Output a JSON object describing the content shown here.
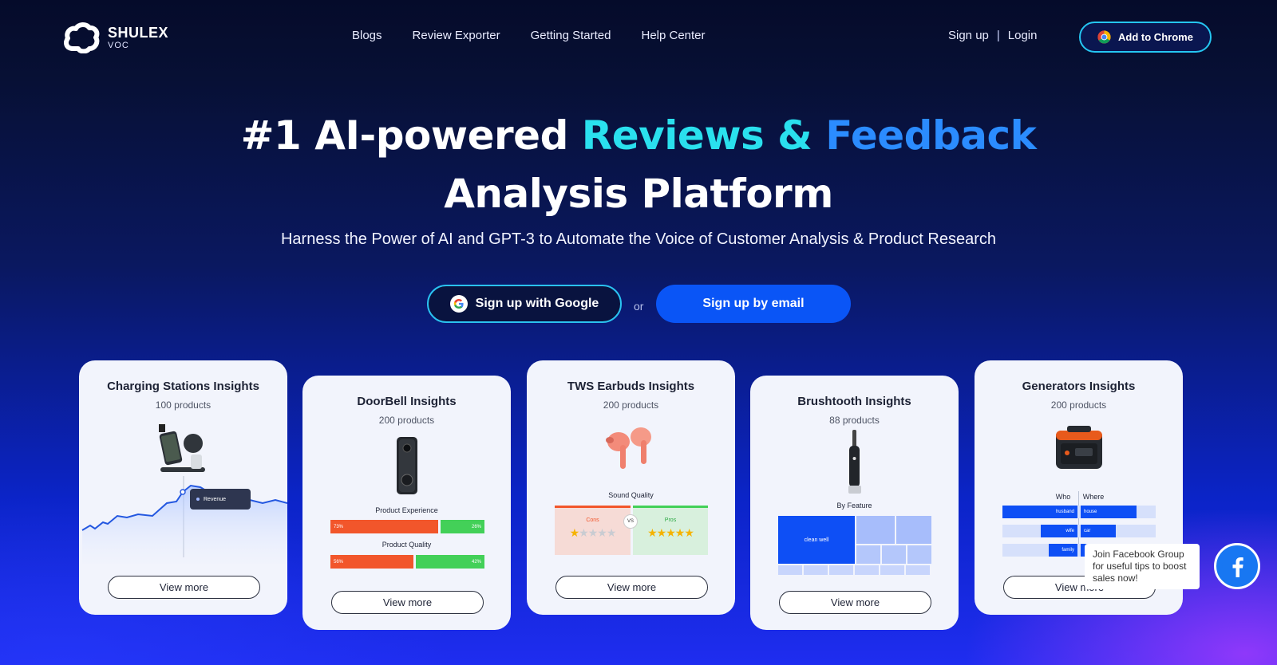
{
  "brand": {
    "name": "SHULEX",
    "sub": "VOC"
  },
  "nav": {
    "links": [
      "Blogs",
      "Review Exporter",
      "Getting Started",
      "Help Center"
    ],
    "signup": "Sign up",
    "separator": "|",
    "login": "Login",
    "chrome_button": "Add to Chrome"
  },
  "hero": {
    "title_part1": "#1 AI-powered ",
    "title_highlight1": "Reviews & ",
    "title_highlight2": "Feedback",
    "title_line2": "Analysis Platform",
    "subtitle": "Harness the Power of AI and GPT-3 to Automate the Voice of Customer Analysis & Product Research",
    "google_button": "Sign up with Google",
    "or": "or",
    "email_button": "Sign up by email"
  },
  "cards": [
    {
      "title": "Charging Stations Insights",
      "count": "100 products",
      "tooltip": "Revenue",
      "button": "View more"
    },
    {
      "title": "DoorBell Insights",
      "count": "200 products",
      "label1": "Product Experience",
      "bar1_neg": "73%",
      "bar1_pos": "26%",
      "label2": "Product Quality",
      "bar2_neg": "56%",
      "bar2_pos": "42%",
      "bar1_neg_frac": 0.73,
      "bar2_neg_frac": 0.56,
      "button": "View more"
    },
    {
      "title": "TWS Earbuds Insights",
      "count": "200 products",
      "label": "Sound Quality",
      "cons": "Cons",
      "vs": "VS",
      "pros": "Pros",
      "cons_rating": 1,
      "pros_rating": 5,
      "button": "View more"
    },
    {
      "title": "Brushtooth Insights",
      "count": "88 products",
      "label": "By Feature",
      "tile": "clean well",
      "button": "View more"
    },
    {
      "title": "Generators Insights",
      "count": "200 products",
      "who": "Who",
      "where": "Where",
      "who_items": [
        "husband",
        "wife",
        "family"
      ],
      "where_items": [
        "house",
        "car",
        ""
      ],
      "button": "View more"
    }
  ],
  "facebook": {
    "tooltip": "Join Facebook Group for useful tips to boost sales now!"
  },
  "colors": {
    "accent_cyan": "#2ae0ee",
    "accent_blue": "#2b8cff",
    "primary_button": "#0a55f6"
  }
}
